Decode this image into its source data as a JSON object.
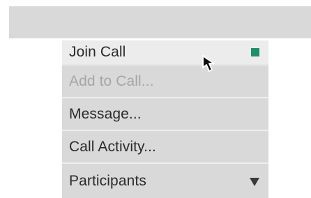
{
  "menu": {
    "items": [
      {
        "label": "Join Call",
        "state": "hovered",
        "status_color": "#1f8f6a"
      },
      {
        "label": "Add to Call...",
        "state": "disabled"
      },
      {
        "label": "Message...",
        "state": "normal"
      },
      {
        "label": "Call Activity...",
        "state": "normal"
      },
      {
        "label": "Participants",
        "state": "normal",
        "icon": "dropdown-triangle-icon"
      }
    ]
  },
  "cursor": {
    "icon": "arrow-pointer-icon"
  }
}
